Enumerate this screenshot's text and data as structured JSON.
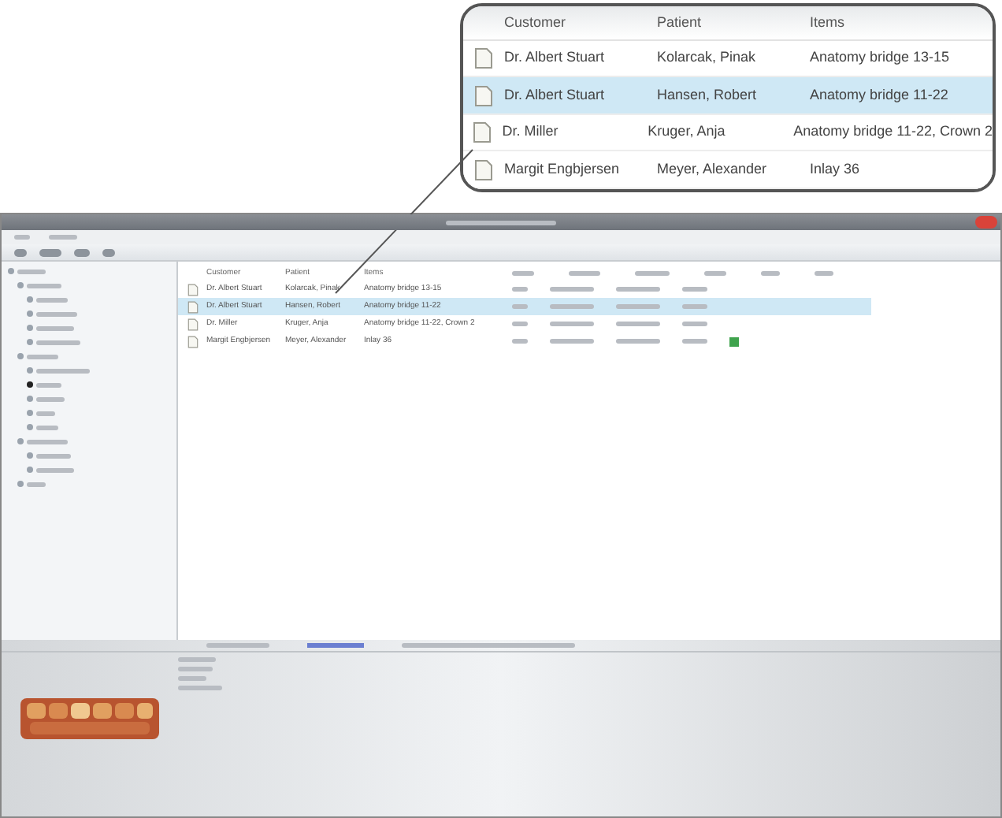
{
  "callout": {
    "columns": [
      "Customer",
      "Patient",
      "Items"
    ],
    "rows": [
      {
        "customer": "Dr. Albert Stuart",
        "patient": "Kolarcak, Pinak",
        "items": "Anatomy bridge 13-15",
        "selected": false
      },
      {
        "customer": "Dr. Albert Stuart",
        "patient": "Hansen, Robert",
        "items": "Anatomy bridge 11-22",
        "selected": true
      },
      {
        "customer": "Dr. Miller",
        "patient": "Kruger, Anja",
        "items": "Anatomy bridge 11-22, Crown 2",
        "selected": false
      },
      {
        "customer": "Margit Engbjersen",
        "patient": "Meyer, Alexander",
        "items": "Inlay 36",
        "selected": false
      }
    ]
  },
  "table": {
    "columns": [
      "Customer",
      "Patient",
      "Items"
    ],
    "rows": [
      {
        "customer": "Dr. Albert Stuart",
        "patient": "Kolarcak, Pinak",
        "items": "Anatomy bridge 13-15",
        "selected": false,
        "marked": false
      },
      {
        "customer": "Dr. Albert Stuart",
        "patient": "Hansen, Robert",
        "items": "Anatomy bridge 11-22",
        "selected": true,
        "marked": false
      },
      {
        "customer": "Dr. Miller",
        "patient": "Kruger, Anja",
        "items": "Anatomy bridge 11-22, Crown 2",
        "selected": false,
        "marked": false
      },
      {
        "customer": "Margit Engbjersen",
        "patient": "Meyer, Alexander",
        "items": "Inlay 36",
        "selected": false,
        "marked": true
      }
    ]
  }
}
